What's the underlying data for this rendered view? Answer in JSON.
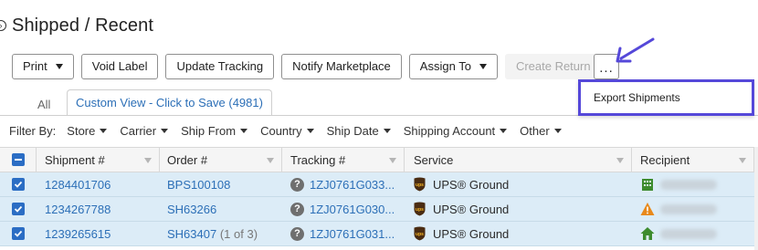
{
  "page": {
    "title": "Shipped / Recent"
  },
  "toolbar": {
    "print": "Print",
    "void_label": "Void Label",
    "update_tracking": "Update Tracking",
    "notify_marketplace": "Notify Marketplace",
    "assign_to": "Assign To",
    "create_return": "Create Return",
    "more": "..."
  },
  "dropdown": {
    "export_shipments": "Export Shipments"
  },
  "tabs": {
    "all": "All",
    "custom_view": "Custom View - Click to Save (4981)"
  },
  "filters": {
    "label": "Filter By:",
    "items": [
      "Store",
      "Carrier",
      "Ship From",
      "Country",
      "Ship Date",
      "Shipping Account",
      "Other"
    ]
  },
  "table": {
    "headers": {
      "shipment": "Shipment #",
      "order": "Order #",
      "tracking": "Tracking #",
      "service": "Service",
      "recipient": "Recipient"
    },
    "rows": [
      {
        "shipment": "1284401706",
        "order": "BPS100108",
        "order_suffix": "",
        "tracking": "1ZJ0761G033...",
        "service": "UPS® Ground",
        "recipient_icon": "building-icon"
      },
      {
        "shipment": "1234267788",
        "order": "SH63266",
        "order_suffix": "",
        "tracking": "1ZJ0761G030...",
        "service": "UPS® Ground",
        "recipient_icon": "warning-icon"
      },
      {
        "shipment": "1239265615",
        "order": "SH63407",
        "order_suffix": "(1 of 3)",
        "tracking": "1ZJ0761G031...",
        "service": "UPS® Ground",
        "recipient_icon": "home-icon"
      }
    ]
  },
  "colors": {
    "accent": "#2c6fb7",
    "selected_row": "#dcecf7",
    "annotation": "#5548d9"
  }
}
